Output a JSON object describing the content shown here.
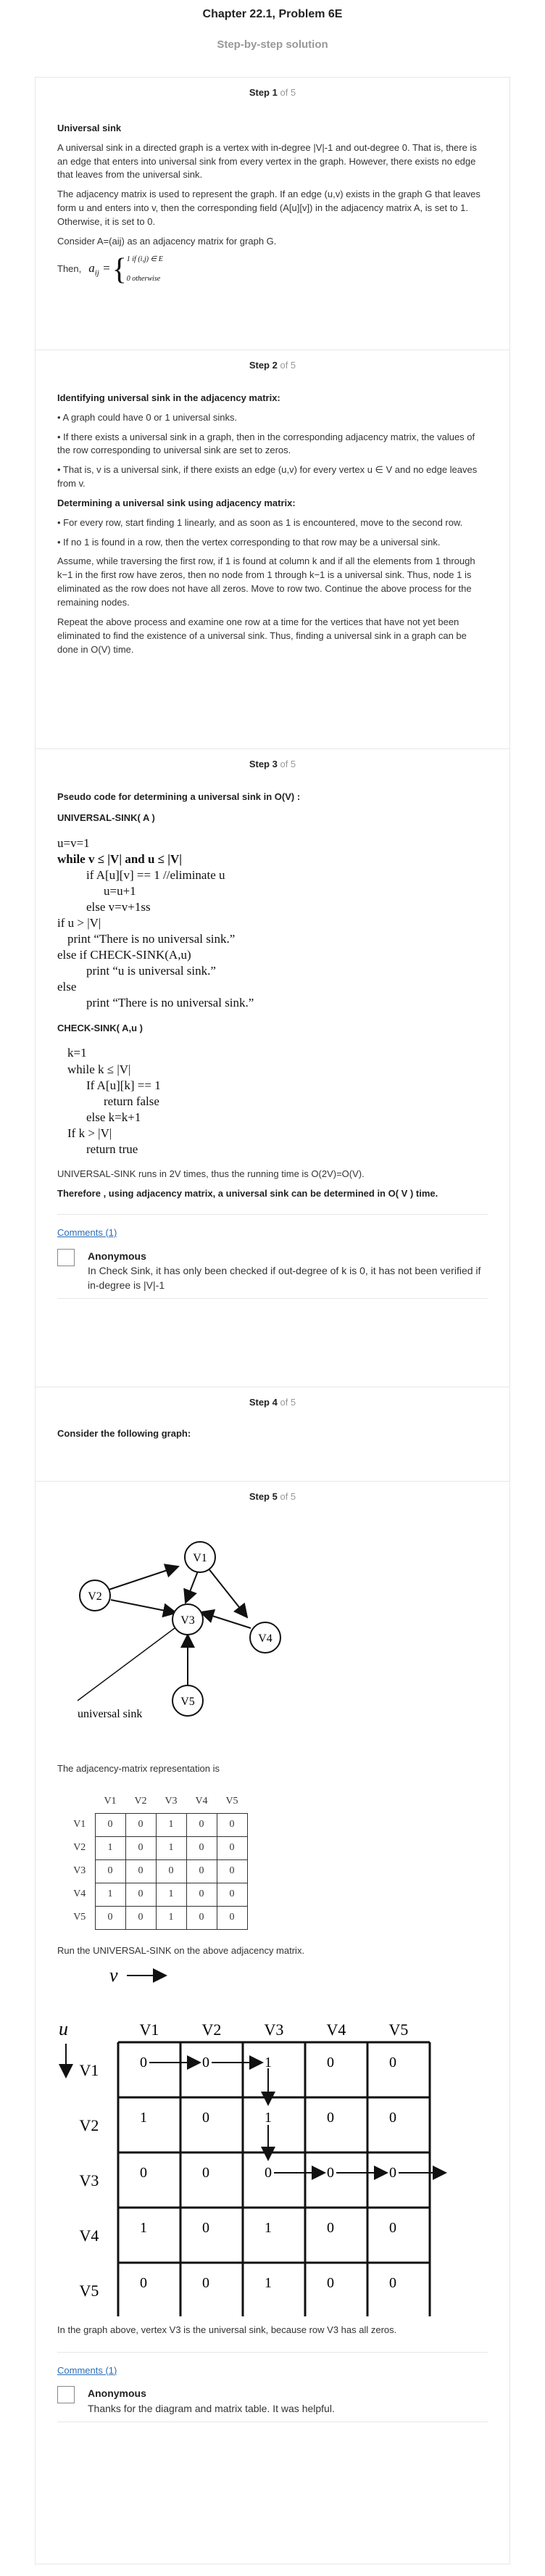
{
  "header": {
    "title": "Chapter 22.1, Problem 6E",
    "subtitle": "Step-by-step solution"
  },
  "steps": [
    {
      "label": "Step 1",
      "of": "of 5"
    },
    {
      "label": "Step 2",
      "of": "of 5"
    },
    {
      "label": "Step 3",
      "of": "of 5"
    },
    {
      "label": "Step 4",
      "of": "of 5"
    },
    {
      "label": "Step 5",
      "of": "of 5"
    }
  ],
  "s1": {
    "heading": "Universal sink",
    "p1": "A universal sink in a directed graph is a vertex with in-degree |V|-1 and out-degree 0. That is, there is an edge that enters into universal sink from every vertex in the graph. However, there exists no edge that leaves from the universal sink.",
    "p2": "The adjacency matrix is used to represent the graph. If an edge (u,v) exists in the graph G that leaves form u and enters into v, then the corresponding field (A[u][v]) in the adjacency matrix A, is set to 1. Otherwise, it is set to 0.",
    "p3": "Consider A=(aij) as an adjacency matrix for graph G.",
    "then": "Then,",
    "case1": "1 if (i,j) ∈ E",
    "case2": "0 otherwise"
  },
  "s2": {
    "h1": "Identifying universal sink in the adjacency matrix:",
    "b1": "• A graph could have 0 or 1 universal sinks.",
    "b2": "• If there exists a universal sink in a graph, then in the corresponding adjacency matrix, the values of the row corresponding to universal sink are set to zeros.",
    "b3": "• That is, v is a universal sink, if there exists an edge (u,v) for every vertex u ∈ V and no edge leaves from v.",
    "h2": "Determining a universal sink using adjacency matrix:",
    "b4": "• For every row, start finding 1 linearly, and as soon as 1 is encountered, move to the second row.",
    "b5": "• If no 1 is found in a row, then the vertex corresponding to that row may be a universal sink.",
    "p1": "Assume, while traversing the first row, if 1 is found at column k and if all the elements from 1 through k−1 in the first row have zeros, then no node from 1 through k−1 is a universal sink. Thus, node 1 is eliminated as the row does not have all zeros. Move to row two. Continue the above process for the remaining nodes.",
    "p2": "Repeat the above process and examine one row at a time for the vertices that have not yet been eliminated to find the existence of a universal sink. Thus, finding a universal sink in a graph can be done in O(V) time."
  },
  "s3": {
    "h1": "Pseudo code for determining a universal sink in O(V) :",
    "f1": "UNIVERSAL-SINK( A )",
    "c1": [
      "u=v=1",
      "while v ≤ |V| and u ≤ |V|",
      "if A[u][v] == 1 //eliminate u",
      "u=u+1",
      "else v=v+1ss",
      "if u > |V|",
      "print “There is no universal sink.”",
      "else if CHECK-SINK(A,u)",
      "print “u is universal sink.”",
      "else",
      "print “There is no universal sink.”"
    ],
    "f2": "CHECK-SINK( A,u )",
    "c2": [
      "k=1",
      "while k ≤ |V|",
      "If A[u][k] == 1",
      "return false",
      "else k=k+1",
      "If k > |V|",
      "return true"
    ],
    "p1": "UNIVERSAL-SINK runs in 2V times, thus the running time is O(2V)=O(V).",
    "p2": "Therefore , using adjacency matrix, a universal sink can be determined in O( V ) time.",
    "comments": "Comments (1)",
    "cname": "Anonymous",
    "ctext": "In Check Sink, it has only been checked if out-degree of k is 0, it has not been verified if in-degree is |V|-1"
  },
  "s4": {
    "text": "Consider the following graph:"
  },
  "s5": {
    "nodes": [
      "V1",
      "V2",
      "V3",
      "V4",
      "V5"
    ],
    "sinklabel": "universal sink",
    "p1": "The adjacency-matrix representation is",
    "matrix": [
      [
        0,
        0,
        1,
        0,
        0
      ],
      [
        1,
        0,
        1,
        0,
        0
      ],
      [
        0,
        0,
        0,
        0,
        0
      ],
      [
        1,
        0,
        1,
        0,
        0
      ],
      [
        0,
        0,
        1,
        0,
        0
      ]
    ],
    "p2": "Run the UNIVERSAL-SINK on the above adjacency matrix.",
    "vlabel": "v",
    "ulabel": "u",
    "p3": "In the graph above, vertex V3 is the universal sink, because row V3 has all zeros.",
    "comments": "Comments (1)",
    "cname": "Anonymous",
    "ctext": "Thanks for the diagram and matrix table. It was helpful."
  }
}
